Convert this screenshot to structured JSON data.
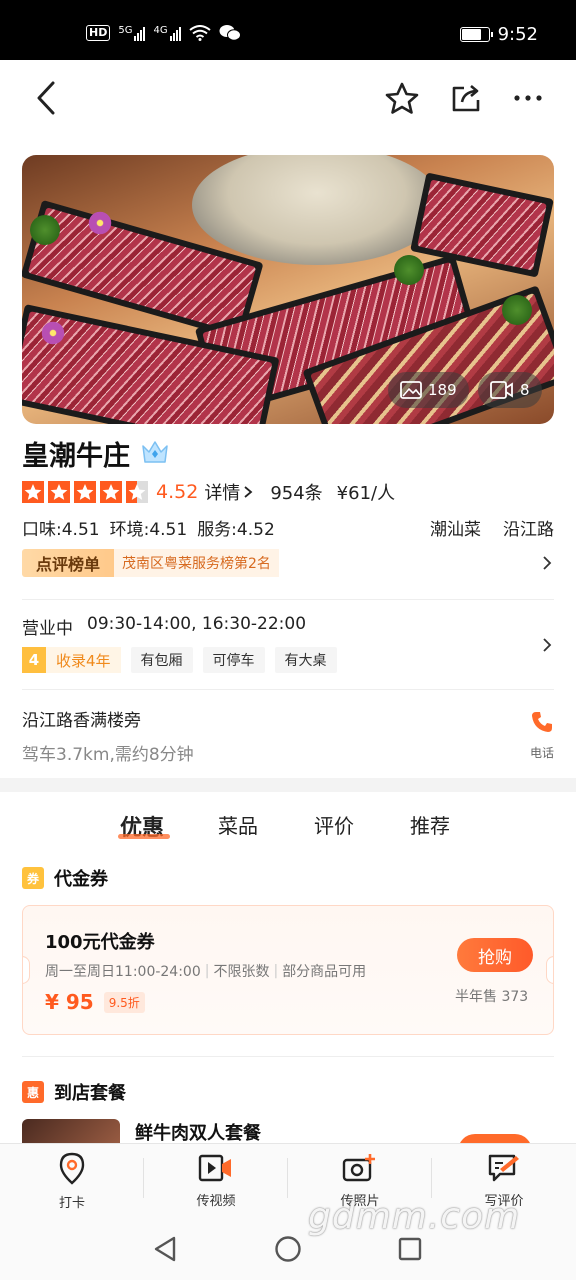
{
  "status_bar": {
    "network_badge": "HD",
    "sig1_label": "5G",
    "sig2_label": "4G",
    "time": "9:52",
    "battery_level": 0.75
  },
  "hero": {
    "photo_count": "189",
    "video_count": "8"
  },
  "shop": {
    "name": "皇潮牛庄",
    "rating": "4.52",
    "rating_value": 4.52,
    "details_label": "详情",
    "review_count": "954条",
    "avg_price": "¥61/人",
    "taste": "口味:4.51",
    "environment": "环境:4.51",
    "service": "服务:4.52",
    "cuisine": "潮汕菜",
    "area": "沿江路",
    "rank_badge": "点评榜单",
    "rank_text": "茂南区粤菜服务榜第2名",
    "status": "营业中",
    "hours": "09:30-14:00, 16:30-22:00",
    "years_num": "4",
    "years_label": "收录4年",
    "tags": [
      "有包厢",
      "可停车",
      "有大桌"
    ],
    "address": "沿江路香满楼旁",
    "drive_info": "驾车3.7km,需约8分钟",
    "phone_label": "电话"
  },
  "tabs": [
    "优惠",
    "菜品",
    "评价",
    "推荐"
  ],
  "voucher_section": {
    "icon_text": "券",
    "title": "代金券",
    "coupon": {
      "title": "100元代金券",
      "desc_time": "周一至周日11:00-24:00",
      "desc_limit": "不限张数",
      "desc_scope": "部分商品可用",
      "price": "¥ 95",
      "discount": "9.5折",
      "buy_label": "抢购",
      "sold": "半年售 373"
    }
  },
  "package_section": {
    "icon_text": "惠",
    "title": "到店套餐",
    "item_title": "鲜牛肉双人套餐"
  },
  "bottom_bar": {
    "checkin": "打卡",
    "video": "传视频",
    "photo": "传照片",
    "review": "写评价"
  },
  "watermark": "gdmm.com",
  "colors": {
    "accent": "#ff5a1f",
    "star": "#ff5a1f"
  }
}
